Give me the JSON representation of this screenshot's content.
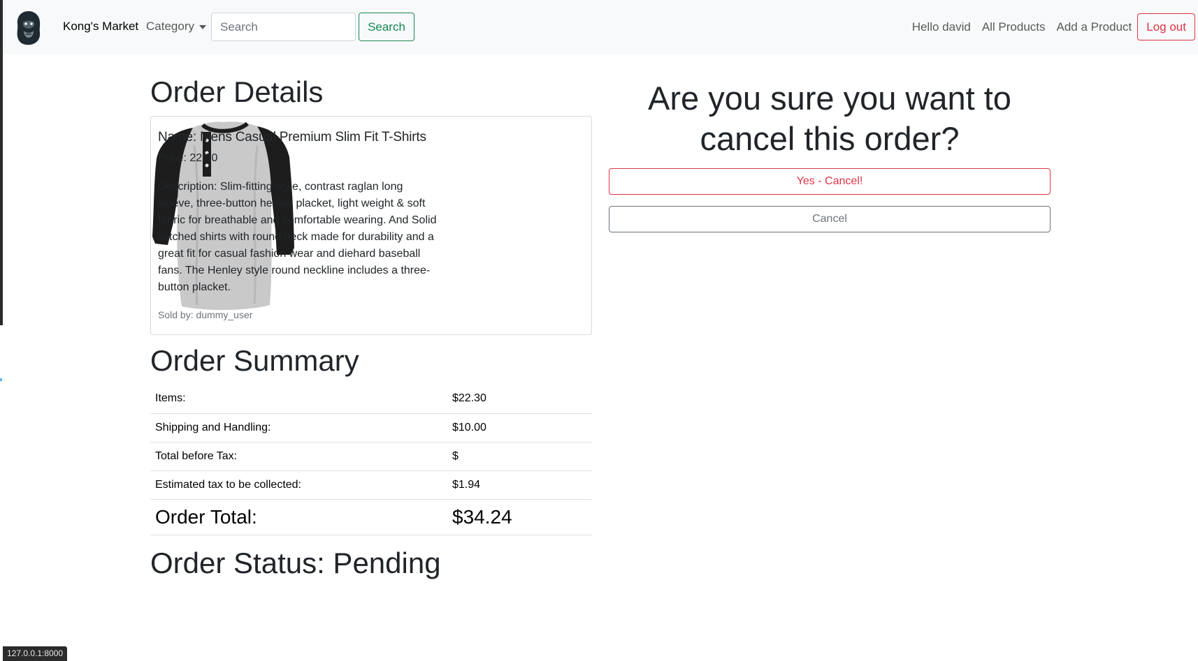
{
  "navbar": {
    "brand": "Kong's Market",
    "category_label": "Category",
    "search_placeholder": "Search",
    "search_button": "Search",
    "greeting": "Hello david",
    "all_products": "All Products",
    "add_product": "Add a Product",
    "logout": "Log out"
  },
  "order_details": {
    "heading": "Order Details",
    "product": {
      "name": "Name: Mens Casual Premium Slim Fit T-Shirts",
      "price": "Price: 22.30",
      "description": "Description: Slim-fitting style, contrast raglan long sleeve, three-button henley placket, light weight & soft fabric for breathable and comfortable wearing. And Solid stitched shirts with round neck made for durability and a great fit for casual fashion wear and diehard baseball fans. The Henley style round neckline includes a three-button placket.",
      "seller": "Sold by: dummy_user"
    }
  },
  "order_summary": {
    "heading": "Order Summary",
    "rows": [
      {
        "label": "Items:",
        "value": "$22.30"
      },
      {
        "label": "Shipping and Handling:",
        "value": "$10.00"
      },
      {
        "label": "Total before Tax:",
        "value": "$"
      },
      {
        "label": "Estimated tax to be collected:",
        "value": "$1.94"
      }
    ],
    "total_label": "Order Total:",
    "total_value": "$34.24"
  },
  "order_status": "Order Status: Pending",
  "confirm": {
    "title": "Are you sure you want to cancel this order?",
    "yes_button": "Yes - Cancel!",
    "cancel_button": "Cancel"
  },
  "status_bar_url": "127.0.0.1:8000",
  "colors": {
    "success": "#198754",
    "danger": "#dc3545",
    "secondary": "#6c757d",
    "navbar_bg": "#f8f9fa"
  },
  "icons": {
    "logo": "gorilla-logo-icon",
    "dropdown": "chevron-down-icon",
    "product_image": "henley-tshirt-image"
  }
}
